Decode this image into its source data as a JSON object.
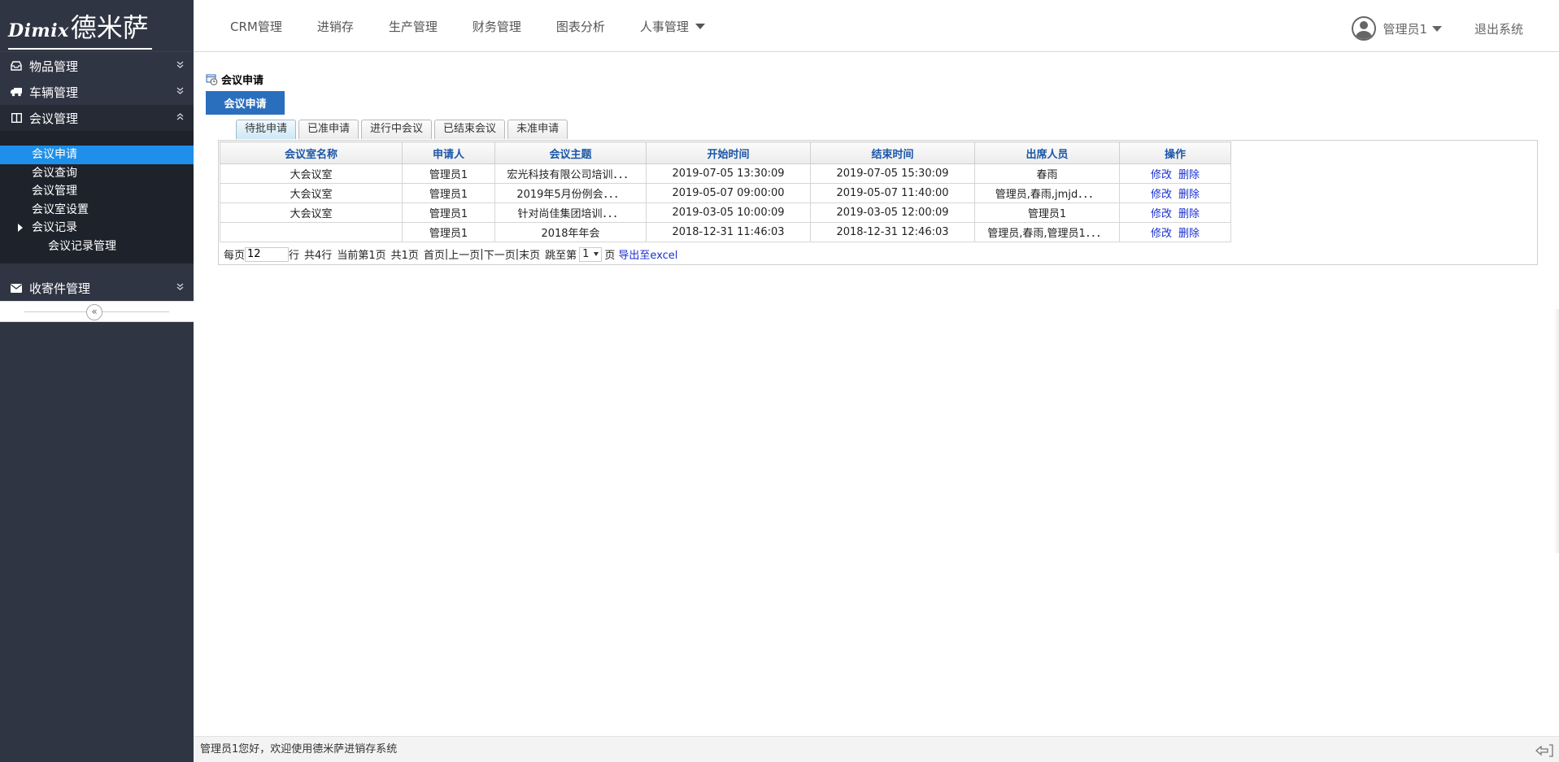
{
  "logo": {
    "latin": "Dimix",
    "cjk": "德米萨"
  },
  "sidebar": {
    "groups": [
      {
        "label": "物品管理",
        "icon": "drawer-icon",
        "state": "collapsed"
      },
      {
        "label": "车辆管理",
        "icon": "truck-icon",
        "state": "collapsed"
      },
      {
        "label": "会议管理",
        "icon": "columns-icon",
        "state": "expanded"
      },
      {
        "label": "收寄件管理",
        "icon": "envelope-icon",
        "state": "collapsed"
      }
    ],
    "meeting_items": [
      {
        "label": "会议申请",
        "selected": true
      },
      {
        "label": "会议查询"
      },
      {
        "label": "会议管理"
      },
      {
        "label": "会议室设置"
      },
      {
        "label": "会议记录",
        "has_children": true
      },
      {
        "label": "会议记录管理",
        "level": 2
      }
    ],
    "collapse_glyph": "«"
  },
  "topnav": {
    "items": [
      "CRM管理",
      "进销存",
      "生产管理",
      "财务管理",
      "图表分析",
      "人事管理"
    ],
    "user": "管理员1",
    "logout": "退出系统"
  },
  "page": {
    "title": "会议申请",
    "main_tab": "会议申请",
    "subtabs": [
      "待批申请",
      "已准申请",
      "进行中会议",
      "已结束会议",
      "未准申请"
    ],
    "active_subtab": 0
  },
  "grid": {
    "columns": [
      "会议室名称",
      "申请人",
      "会议主题",
      "开始时间",
      "结束时间",
      "出席人员",
      "操作"
    ],
    "rows": [
      {
        "room": "大会议室",
        "applicant": "管理员1",
        "topic": "宏光科技有限公司培训．．．",
        "start": "2019-07-05 13:30:09",
        "end": "2019-07-05 15:30:09",
        "attendees": "春雨"
      },
      {
        "room": "大会议室",
        "applicant": "管理员1",
        "topic": "2019年5月份例会．．．",
        "start": "2019-05-07 09:00:00",
        "end": "2019-05-07 11:40:00",
        "attendees": "管理员,春雨,jmjd．．．"
      },
      {
        "room": "大会议室",
        "applicant": "管理员1",
        "topic": "针对尚佳集团培训．．．",
        "start": "2019-03-05 10:00:09",
        "end": "2019-03-05 12:00:09",
        "attendees": "管理员1"
      },
      {
        "room": "",
        "applicant": "管理员1",
        "topic": "2018年年会",
        "start": "2018-12-31 11:46:03",
        "end": "2018-12-31 12:46:03",
        "attendees": "管理员,春雨,管理员1．．．"
      }
    ],
    "actions": {
      "edit": "修改",
      "delete": "删除"
    }
  },
  "pager": {
    "per_page_prefix": "每页",
    "per_page_value": "12",
    "per_page_suffix": "行",
    "total_rows": "共4行",
    "current_page": "当前第1页",
    "total_pages": "共1页",
    "first": "首页",
    "prev": "上一页",
    "next": "下一页",
    "last": "末页",
    "sep": "|",
    "jump_prefix": "跳至第",
    "jump_value": "1",
    "jump_suffix": "页",
    "export": "导出至excel"
  },
  "footer": {
    "welcome": "管理员1您好，欢迎使用德米萨进销存系统"
  },
  "colors": {
    "sidebar_bg": "#2f3543",
    "accent": "#1e8fea",
    "tab_blue": "#2a6fbd",
    "link": "#1a2fd1",
    "header_text": "#1a56a8"
  }
}
